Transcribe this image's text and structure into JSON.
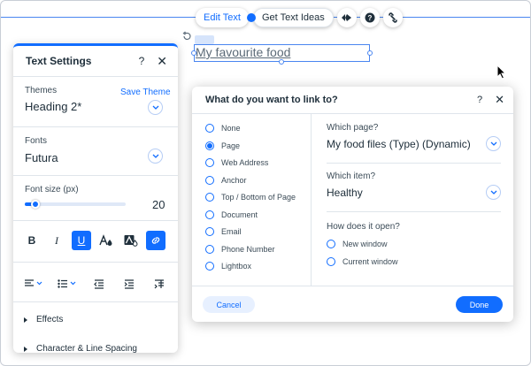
{
  "toolbar": {
    "edit_text_label": "Edit Text",
    "get_ideas_label": "Get Text Ideas",
    "icons": [
      "animation-icon",
      "help-icon",
      "link-icon"
    ]
  },
  "canvas": {
    "text_element": "My favourite food"
  },
  "text_settings": {
    "title": "Text Settings",
    "themes_label": "Themes",
    "save_theme_label": "Save Theme",
    "theme_value": "Heading 2*",
    "fonts_label": "Fonts",
    "font_value": "Futura",
    "font_size_label": "Font size (px)",
    "font_size_value": "20",
    "font_size_slider_fraction": 0.08,
    "format_buttons": [
      "bold",
      "italic",
      "underline",
      "text-color",
      "highlight",
      "link"
    ],
    "bold_glyph": "B",
    "italic_glyph": "I",
    "underline_glyph": "U",
    "effects_label": "Effects",
    "spacing_label": "Character & Line Spacing"
  },
  "link_dialog": {
    "title": "What do you want to link to?",
    "options": [
      "None",
      "Page",
      "Web Address",
      "Anchor",
      "Top / Bottom of Page",
      "Document",
      "Email",
      "Phone Number",
      "Lightbox"
    ],
    "selected_option": "Page",
    "which_page_label": "Which page?",
    "which_page_value": "My food files (Type) (Dynamic)",
    "which_item_label": "Which item?",
    "which_item_value": "Healthy",
    "open_label": "How does it open?",
    "open_options": [
      "New window",
      "Current window"
    ],
    "cancel_label": "Cancel",
    "done_label": "Done"
  },
  "colors": {
    "accent": "#116dff",
    "text": "#20303c",
    "border": "#dfe5eb"
  }
}
